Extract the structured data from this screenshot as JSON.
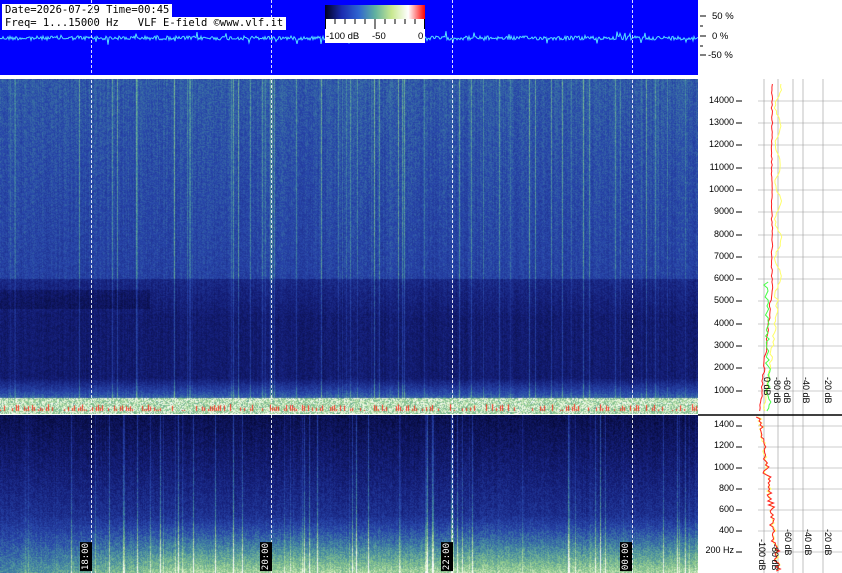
{
  "header": {
    "date_line": "Date=2026-07-29 Time=00:45",
    "freq_line": "Freq= 1...15000 Hz   VLF E-field ©www.vlf.it"
  },
  "colorbar": {
    "ticks": [
      "-100 dB",
      "-50",
      "0"
    ],
    "colors": [
      "#000022",
      "#1a2bb0",
      "#2e63d0",
      "#5fb0a0",
      "#c8e890",
      "#ffffff",
      "#ff0000"
    ]
  },
  "amplitude_scale": [
    "50 %",
    "0 %",
    "-50 %"
  ],
  "main_freq_axis": [
    "14000",
    "13000",
    "12000",
    "11000",
    "10000",
    "9000",
    "8000",
    "7000",
    "6000",
    "5000",
    "4000",
    "3000",
    "2000",
    "1000"
  ],
  "low_freq_axis": [
    "1400",
    "1200",
    "1000",
    "800",
    "600",
    "400",
    "200 Hz"
  ],
  "db_axis_top": [
    "0 dB",
    "-20 dB",
    "-40 dB",
    "-60 dB",
    "-80 dB"
  ],
  "db_axis_bottom": [
    "-20 dB",
    "-40 dB",
    "-60 dB",
    "-80 dB",
    "-100 dB"
  ],
  "time_labels": [
    "18:00",
    "20:00",
    "22:00",
    "00:00"
  ],
  "accent_colors": {
    "waveform_bg": "#0000ff",
    "waveform_trace": "#55ddff",
    "profile_yellow": "#ffff66",
    "profile_red": "#ff2020",
    "profile_green": "#44ff44"
  }
}
